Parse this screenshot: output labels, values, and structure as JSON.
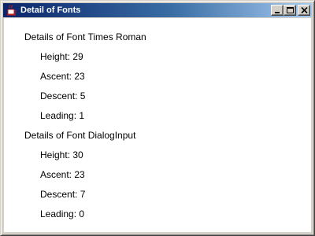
{
  "window": {
    "title": "Detail of Fonts"
  },
  "fonts": [
    {
      "heading": "Details of Font Times Roman",
      "height": "Height: 29",
      "ascent": "Ascent: 23",
      "descent": "Descent: 5",
      "leading": "Leading: 1"
    },
    {
      "heading": "Details of Font DialogInput",
      "height": "Height: 30",
      "ascent": "Ascent: 23",
      "descent": "Descent: 7",
      "leading": "Leading: 0"
    }
  ],
  "icons": {
    "app": "java-cup-icon",
    "minimize": "minimize-icon",
    "maximize": "maximize-icon",
    "close": "close-icon"
  },
  "colors": {
    "titlebar_start": "#0a246a",
    "titlebar_end": "#a6caf0",
    "content_background": "#ffffff"
  }
}
